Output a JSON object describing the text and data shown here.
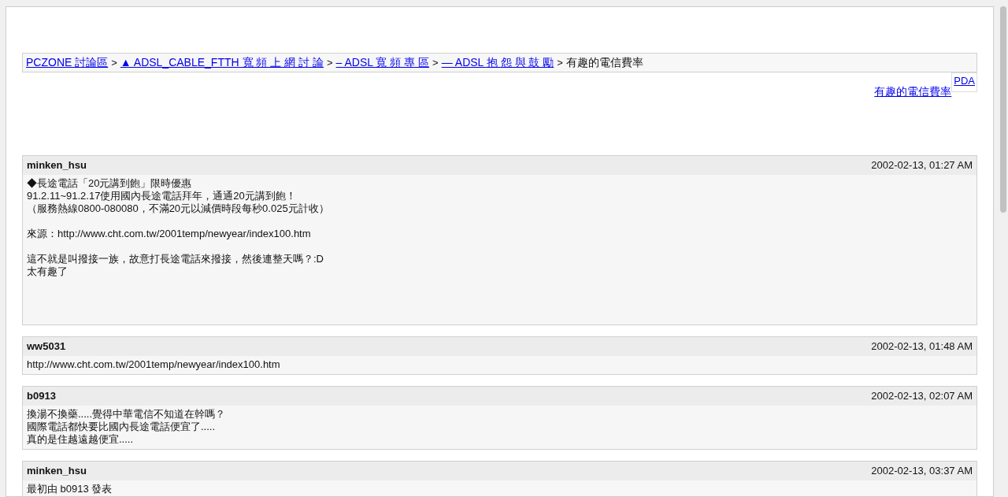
{
  "breadcrumb": {
    "links": [
      "PCZONE 討論區",
      "▲ ADSL_CABLE_FTTH 寬 頻 上 網 討 論",
      "– ADSL 寬 頻 專 區",
      "— ADSL 抱 怨 與 鼓 勵"
    ],
    "separator": ">",
    "current": "有趣的電信費率"
  },
  "thread_link": "有趣的電信費率",
  "pda_link": "PDA",
  "posts": [
    {
      "author": "minken_hsu",
      "date": "2002-02-13, 01:27 AM",
      "paragraphs": [
        [
          "◆長途電話「20元講到飽」限時優惠",
          "91.2.11~91.2.17使用國內長途電話拜年，通通20元講到飽！",
          "（服務熱線0800-080080，不滿20元以減價時段每秒0.025元計收）"
        ],
        [
          "來源：http://www.cht.com.tw/2001temp/newyear/index100.htm"
        ],
        [
          "這不就是叫撥接一族，故意打長途電話來撥接，然後連整天嗎？:D",
          "太有趣了"
        ]
      ]
    },
    {
      "author": "ww5031",
      "date": "2002-02-13, 01:48 AM",
      "paragraphs": [
        [
          "http://www.cht.com.tw/2001temp/newyear/index100.htm"
        ]
      ]
    },
    {
      "author": "b0913",
      "date": "2002-02-13, 02:07 AM",
      "paragraphs": [
        [
          "換湯不換藥.....覺得中華電信不知道在幹嗎？",
          "國際電話都快要比國內長途電話便宜了.....",
          "真的是住越遠越便宜....."
        ]
      ]
    },
    {
      "author": "minken_hsu",
      "date": "2002-02-13, 03:37 AM",
      "paragraphs": [
        [
          "最初由 b0913 發表"
        ]
      ]
    }
  ]
}
